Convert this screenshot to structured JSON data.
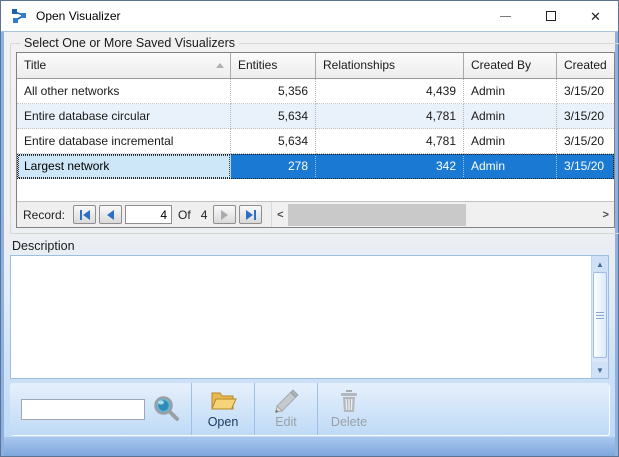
{
  "window": {
    "title": "Open Visualizer",
    "controls": {
      "minimize": "",
      "maximize": "",
      "close": "✕"
    }
  },
  "groupbox": {
    "label": "Select One or More Saved Visualizers"
  },
  "grid": {
    "columns": [
      {
        "label": "Title",
        "sort": "ascending"
      },
      {
        "label": "Entities"
      },
      {
        "label": "Relationships"
      },
      {
        "label": "Created By"
      },
      {
        "label": "Created"
      }
    ],
    "rows": [
      {
        "title": "All other networks",
        "entities": "5,356",
        "relationships": "4,439",
        "created_by": "Admin",
        "created": "3/15/20",
        "selected": false
      },
      {
        "title": "Entire database circular",
        "entities": "5,634",
        "relationships": "4,781",
        "created_by": "Admin",
        "created": "3/15/20",
        "selected": false
      },
      {
        "title": "Entire database incremental",
        "entities": "5,634",
        "relationships": "4,781",
        "created_by": "Admin",
        "created": "3/15/20",
        "selected": false
      },
      {
        "title": "Largest network",
        "entities": "278",
        "relationships": "342",
        "created_by": "Admin",
        "created": "3/15/20",
        "selected": true
      }
    ]
  },
  "record_navigator": {
    "label": "Record:",
    "current": "4",
    "of_label": "Of",
    "total": "4",
    "hscroll_left": "<",
    "hscroll_right": ">"
  },
  "description": {
    "label": "Description",
    "value": "",
    "scroll_up": "▲",
    "scroll_down": "▼"
  },
  "toolbar": {
    "search_value": "",
    "open_label": "Open",
    "edit_label": "Edit",
    "delete_label": "Delete"
  },
  "colors": {
    "selection_blue": "#1a79d2",
    "focused_cell_blue": "#cde6f8",
    "alt_row_blue": "#e9f2fb",
    "folder_gold": "#f0c35c",
    "disabled_gray": "#9aa0a8",
    "app_icon_blue": "#1b5fae"
  }
}
